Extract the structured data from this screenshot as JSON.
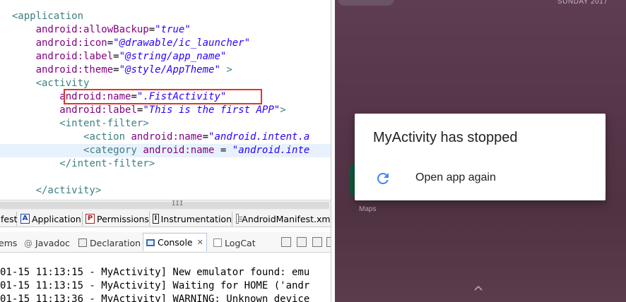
{
  "editor": {
    "lines": [
      {
        "indent": "  ",
        "parts": [
          {
            "t": "tag",
            "v": "<application"
          }
        ]
      },
      {
        "indent": "      ",
        "parts": [
          {
            "t": "attr",
            "v": "android:allowBackup"
          },
          {
            "t": "eq",
            "v": "="
          },
          {
            "t": "val",
            "v": "\"true\""
          }
        ]
      },
      {
        "indent": "      ",
        "parts": [
          {
            "t": "attr",
            "v": "android:icon"
          },
          {
            "t": "eq",
            "v": "="
          },
          {
            "t": "val",
            "v": "\"@drawable/ic_launcher\""
          }
        ]
      },
      {
        "indent": "      ",
        "parts": [
          {
            "t": "attr",
            "v": "android:label"
          },
          {
            "t": "eq",
            "v": "="
          },
          {
            "t": "val",
            "v": "\"@string/app_name\""
          }
        ]
      },
      {
        "indent": "      ",
        "parts": [
          {
            "t": "attr",
            "v": "android:theme"
          },
          {
            "t": "eq",
            "v": "="
          },
          {
            "t": "val",
            "v": "\"@style/AppTheme\""
          },
          {
            "t": "tag",
            "v": " >"
          }
        ]
      },
      {
        "indent": "      ",
        "parts": [
          {
            "t": "tag",
            "v": "<activity"
          }
        ]
      },
      {
        "indent": "          ",
        "parts": [
          {
            "t": "attr",
            "v": "android:name"
          },
          {
            "t": "eq",
            "v": "="
          },
          {
            "t": "val",
            "v": "\".FistActivity\""
          }
        ]
      },
      {
        "indent": "          ",
        "parts": [
          {
            "t": "attr",
            "v": "android:label"
          },
          {
            "t": "eq",
            "v": "="
          },
          {
            "t": "val",
            "v": "\"This is the first APP\""
          },
          {
            "t": "tag",
            "v": ">"
          }
        ]
      },
      {
        "indent": "          ",
        "parts": [
          {
            "t": "tag",
            "v": "<intent-filter>"
          }
        ]
      },
      {
        "indent": "              ",
        "parts": [
          {
            "t": "tag",
            "v": "<action "
          },
          {
            "t": "attr",
            "v": "android:name"
          },
          {
            "t": "eq",
            "v": "="
          },
          {
            "t": "val",
            "v": "\"android.intent.a"
          }
        ]
      },
      {
        "indent": "              ",
        "parts": [
          {
            "t": "tag",
            "v": "<category "
          },
          {
            "t": "attr",
            "v": "android:name"
          },
          {
            "t": "eq",
            "v": " = "
          },
          {
            "t": "val",
            "v": "\"android.inte"
          }
        ],
        "highlight": true
      },
      {
        "indent": "          ",
        "parts": [
          {
            "t": "tag",
            "v": "</intent-filter>"
          }
        ]
      },
      {
        "indent": "",
        "parts": []
      },
      {
        "indent": "      ",
        "parts": [
          {
            "t": "tag",
            "v": "</activity>"
          }
        ]
      }
    ]
  },
  "scrollbar": {
    "grip": "III"
  },
  "manifest_tabs": {
    "manifest": "fest",
    "application": "Application",
    "application_icon": "A",
    "permissions": "Permissions",
    "permissions_icon": "P",
    "instrumentation": "Instrumentation",
    "instrumentation_icon": "I",
    "xml": "AndroidManifest.xml"
  },
  "console_tabs": {
    "problems": "ems",
    "javadoc": "Javadoc",
    "javadoc_icon": "@",
    "declaration": "Declaration",
    "console": "Console",
    "console_close": "✕",
    "logcat": "LogCat"
  },
  "console": {
    "lines": [
      "01-15 11:13:15 - MyActivity] New emulator found: emu",
      "01-15 11:13:15 - MyActivity] Waiting for HOME ('andr",
      "01-15 11:13:36 - MyActivity] WARNING: Unknown device"
    ]
  },
  "emulator": {
    "date": "SUNDAY 2017",
    "maps_label": "Maps",
    "dialog": {
      "title": "MyActivity has stopped",
      "action": "Open app again"
    },
    "colors": {
      "accent": "#4285f4",
      "highlight_box": "#e0342f"
    }
  }
}
